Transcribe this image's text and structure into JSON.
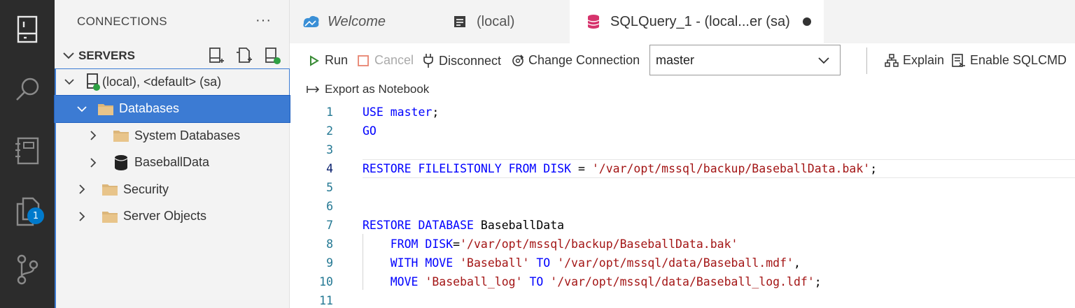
{
  "sidebar": {
    "title": "CONNECTIONS",
    "more": "···",
    "section_title": "SERVERS",
    "tree": [
      {
        "label": "(local), <default> (sa)"
      },
      {
        "label": "Databases"
      },
      {
        "label": "System Databases"
      },
      {
        "label": "BaseballData"
      },
      {
        "label": "Security"
      },
      {
        "label": "Server Objects"
      }
    ]
  },
  "activity": {
    "badge": "1"
  },
  "tabs": [
    {
      "label": "Welcome"
    },
    {
      "label": "(local)"
    },
    {
      "label": "SQLQuery_1 - (local...er (sa)"
    }
  ],
  "toolbar": {
    "run": "Run",
    "cancel": "Cancel",
    "disconnect": "Disconnect",
    "change_connection": "Change Connection",
    "database": "master",
    "explain": "Explain",
    "enable_sqlcmd": "Enable SQLCMD",
    "export_notebook": "Export as Notebook"
  },
  "editor": {
    "current_line": 4,
    "lines": [
      {
        "n": "1"
      },
      {
        "n": "2"
      },
      {
        "n": "3"
      },
      {
        "n": "4"
      },
      {
        "n": "5"
      },
      {
        "n": "6"
      },
      {
        "n": "7"
      },
      {
        "n": "8"
      },
      {
        "n": "9"
      },
      {
        "n": "10"
      },
      {
        "n": "11"
      }
    ],
    "tokens": {
      "l1_kw": "USE master",
      "l1_end": ";",
      "l2_kw": "GO",
      "l4_kw": "RESTORE FILELISTONLY FROM DISK",
      "l4_eq": " = ",
      "l4_str": "'/var/opt/mssql/backup/BaseballData.bak'",
      "l4_end": ";",
      "l7_kw": "RESTORE DATABASE",
      "l7_name": " BaseballData",
      "l8_kw": "FROM DISK",
      "l8_eq": "=",
      "l8_str": "'/var/opt/mssql/backup/BaseballData.bak'",
      "l9_kw": "WITH MOVE",
      "l9_s1": "'Baseball'",
      "l9_to": "TO",
      "l9_s2": "'/var/opt/mssql/data/Baseball.mdf'",
      "l9_end": ",",
      "l10_kw": "MOVE",
      "l10_s1": "'Baseball_log'",
      "l10_to": "TO",
      "l10_s2": "'/var/opt/mssql/data/Baseball_log.ldf'",
      "l10_end": ";"
    }
  },
  "colors": {
    "keyword": "#0000ff",
    "string": "#a31515",
    "selection": "#3c7bd3",
    "activity_bar": "#2c2c2c",
    "badge": "#007acc",
    "run_green": "#388a34"
  }
}
